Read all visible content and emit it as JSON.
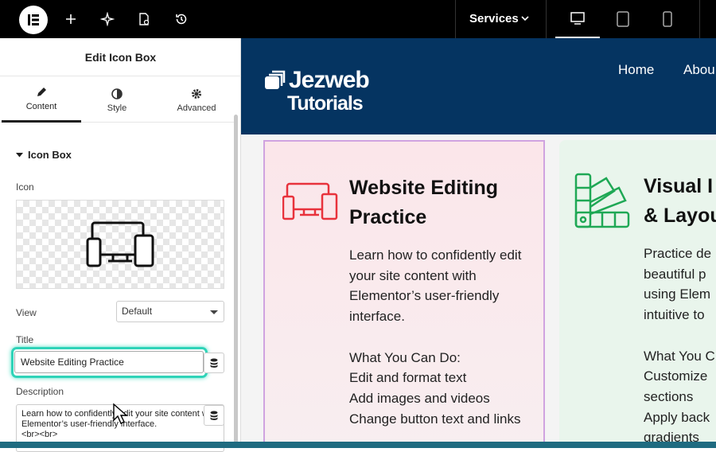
{
  "topbar": {
    "services_label": "Services"
  },
  "panel": {
    "title": "Edit Icon Box",
    "tabs": [
      {
        "label": "Content",
        "icon": "pencil-icon"
      },
      {
        "label": "Style",
        "icon": "contrast-icon"
      },
      {
        "label": "Advanced",
        "icon": "gear-icon"
      }
    ],
    "section_title": "Icon Box",
    "icon_label": "Icon",
    "view_label": "View",
    "view_value": "Default",
    "title_label": "Title",
    "title_value": "Website Editing Practice",
    "description_label": "Description",
    "description_value": "Learn how to confidently edit your site content with Elementor’s user-friendly interface.\n<br><br>"
  },
  "site": {
    "brand_line1": "Jezweb",
    "brand_line2": "Tutorials",
    "nav": [
      "Home",
      "Abou"
    ],
    "card1": {
      "title": "Website Editing Practice",
      "text": "Learn how to confidently edit your site content with Elementor’s user-friendly interface.\n\nWhat You Can Do:\nEdit and format text\nAdd images and videos\nChange button text and links",
      "accent": "#e8323c"
    },
    "card2": {
      "title": "Visual I\n& Layou",
      "text": "Practice de\nbeautiful p\nusing Elem\nintuitive to\n\nWhat You C\nCustomize\nsections\nApply back\ngradients",
      "accent": "#1fa855"
    }
  },
  "colors": {
    "header_bg": "#053461",
    "highlight": "#2fd3b8"
  }
}
